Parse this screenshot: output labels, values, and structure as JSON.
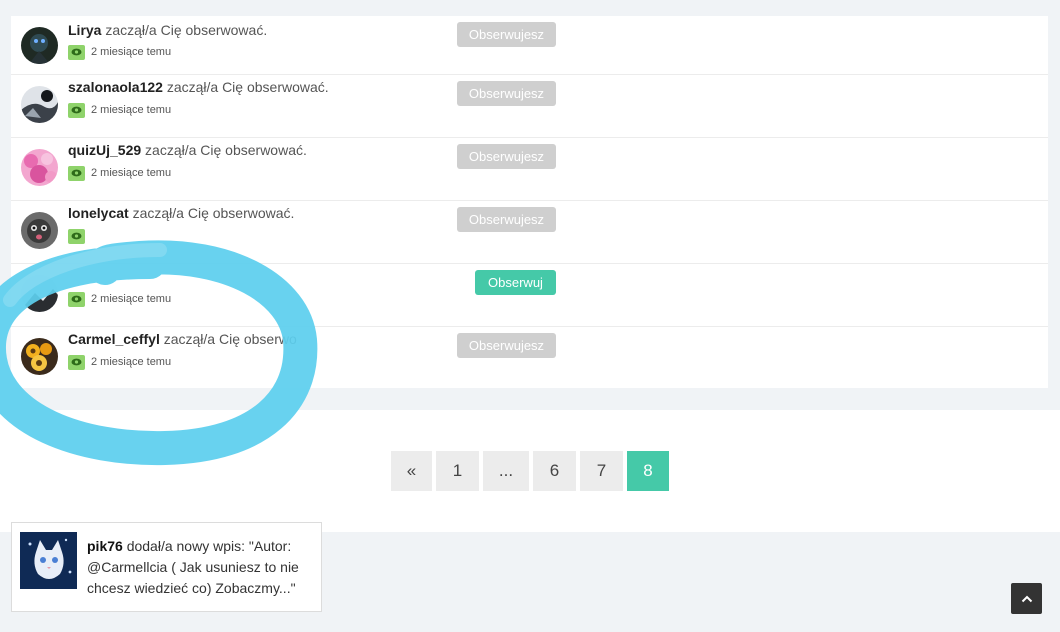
{
  "colors": {
    "accent": "#45c9a8",
    "following_button": "#cfcfcf",
    "eye_badge": "#8fd36b",
    "marker": "#5ccfee"
  },
  "notifications": [
    {
      "username": "Lirya",
      "action": "zaczął/a Cię obserwować.",
      "time": "2 miesiące temu",
      "icon": "eye-icon",
      "button": "Obserwujesz",
      "button_state": "following"
    },
    {
      "username": "szalonaola122",
      "action": "zaczął/a Cię obserwować.",
      "time": "2 miesiące temu",
      "icon": "eye-icon",
      "button": "Obserwujesz",
      "button_state": "following"
    },
    {
      "username": "quizUj_529",
      "action": "zaczął/a Cię obserwować.",
      "time": "2 miesiące temu",
      "icon": "eye-icon",
      "button": "Obserwujesz",
      "button_state": "following"
    },
    {
      "username": "lonelycat",
      "action": "zaczął/a Cię obserwować.",
      "time": "",
      "icon": "eye-icon",
      "button": "Obserwujesz",
      "button_state": "following"
    },
    {
      "username": "",
      "action": "",
      "time": "2 miesiące temu",
      "icon": "eye-icon",
      "button": "Obserwuj",
      "button_state": "follow"
    },
    {
      "username": "Carmel_ceffyl",
      "action": "zaczął/a Cię obserwo",
      "time": "2 miesiące temu",
      "icon": "eye-icon",
      "button": "Obserwujesz",
      "button_state": "following"
    }
  ],
  "pagination": {
    "items": [
      "«",
      "1",
      "...",
      "6",
      "7",
      "8"
    ],
    "current": "8"
  },
  "recent_post": {
    "username": "pik76",
    "text": "dodał/a nowy wpis: \"Autor: @Carmellcia ( Jak usuniesz to nie chcesz wiedzieć co) Zobaczmy...\""
  },
  "scroll_top": {
    "icon": "chevron-up-icon"
  }
}
